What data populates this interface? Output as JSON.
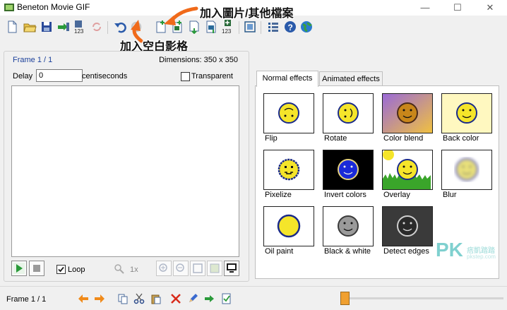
{
  "window": {
    "title": "Beneton Movie GIF",
    "minimize": "—",
    "maximize": "☐",
    "close": "✕"
  },
  "toolbar": {
    "icons": [
      "new-file-icon",
      "open-folder-icon",
      "save-icon",
      "export-icon",
      "export-frames-123-icon",
      "refresh-icon",
      "undo-icon",
      "redo-icon",
      "insert-blank-frame-icon",
      "add-image-icon",
      "insert-below-icon",
      "insert-down-icon",
      "insert-frames-123-icon",
      "fit-icon",
      "list-icon",
      "help-icon",
      "web-globe-icon"
    ]
  },
  "annotations": {
    "add_image_file": "加入圖片/其他檔案",
    "add_blank_frame": "加入空白影格"
  },
  "frame_panel": {
    "frame_info": "Frame 1 / 1",
    "dimensions": "Dimensions: 350 x 350",
    "delay_label": "Delay",
    "delay_value": "0",
    "delay_unit": "centiseconds",
    "transparent_label": "Transparent",
    "transparent_checked": false,
    "loop_label": "Loop",
    "loop_checked": true,
    "zoom_level": "1x"
  },
  "effects": {
    "tabs": [
      "Normal effects",
      "Animated effects"
    ],
    "active_tab": "Normal effects",
    "items": [
      {
        "label": "Flip"
      },
      {
        "label": "Rotate"
      },
      {
        "label": "Color blend"
      },
      {
        "label": "Back color"
      },
      {
        "label": "Pixelize"
      },
      {
        "label": "Invert colors"
      },
      {
        "label": "Overlay"
      },
      {
        "label": "Blur"
      },
      {
        "label": "Oil paint"
      },
      {
        "label": "Black & white"
      },
      {
        "label": "Detect edges"
      }
    ]
  },
  "statusbar": {
    "frame_info": "Frame 1 / 1",
    "position": 0
  },
  "watermark": {
    "brand": "PK",
    "sub": "痞凱踏踏",
    "url": "pkstep.com"
  },
  "colors": {
    "accent_arrow": "#f06a1a",
    "frame_info": "#1a3f9a",
    "slider": "#f0a030"
  }
}
